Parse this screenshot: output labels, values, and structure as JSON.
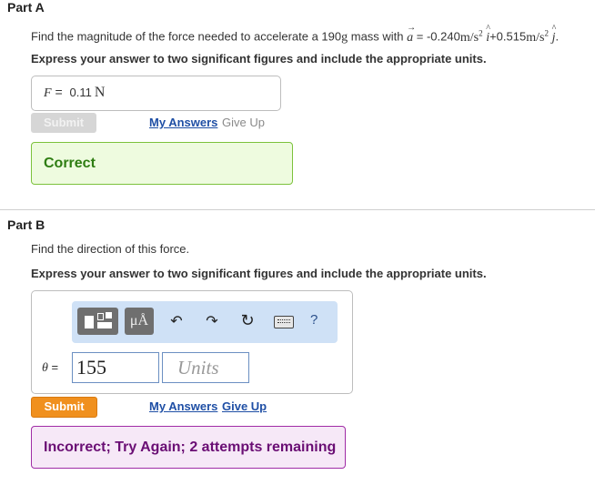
{
  "colors": {
    "correct_bg": "#eefbdf",
    "correct_border": "#7cc23c",
    "correct_text": "#2e7d12",
    "incorrect_bg": "#f6e8f7",
    "incorrect_border": "#a02ca6",
    "incorrect_text": "#6a0e74",
    "link": "#1f4fa5",
    "submit_orange": "#f0901e"
  },
  "part_a": {
    "title": "Part A",
    "question_text": "Find the magnitude of the force needed to accelerate a 190",
    "question_unit": "g",
    "question_text2": " mass with ",
    "vec_a": "a",
    "question_eq": " = -0.240",
    "unit_m": "m/s",
    "unit_exp": "2",
    "i_hat": "i",
    "plus": "+0.515",
    "j_hat": "j",
    "period": ".",
    "instruction": "Express your answer to two significant figures and include the appropriate units.",
    "answer_label": "F",
    "answer_eq": " = ",
    "answer_value": "0.11",
    "answer_unit": "N",
    "submit_label": "Submit",
    "my_answers_label": "My Answers",
    "give_up_label": "Give Up",
    "feedback": "Correct"
  },
  "part_b": {
    "title": "Part B",
    "question_text": "Find the direction of this force.",
    "instruction": "Express your answer to two significant figures and include the appropriate units.",
    "toolbar": {
      "units_label": "μÅ",
      "help_label": "?"
    },
    "answer_label": "θ",
    "answer_eq": " = ",
    "value_input": "155",
    "units_placeholder": "Units",
    "submit_label": "Submit",
    "my_answers_label": "My Answers",
    "give_up_label": "Give Up",
    "feedback": "Incorrect; Try Again; 2 attempts remaining"
  }
}
